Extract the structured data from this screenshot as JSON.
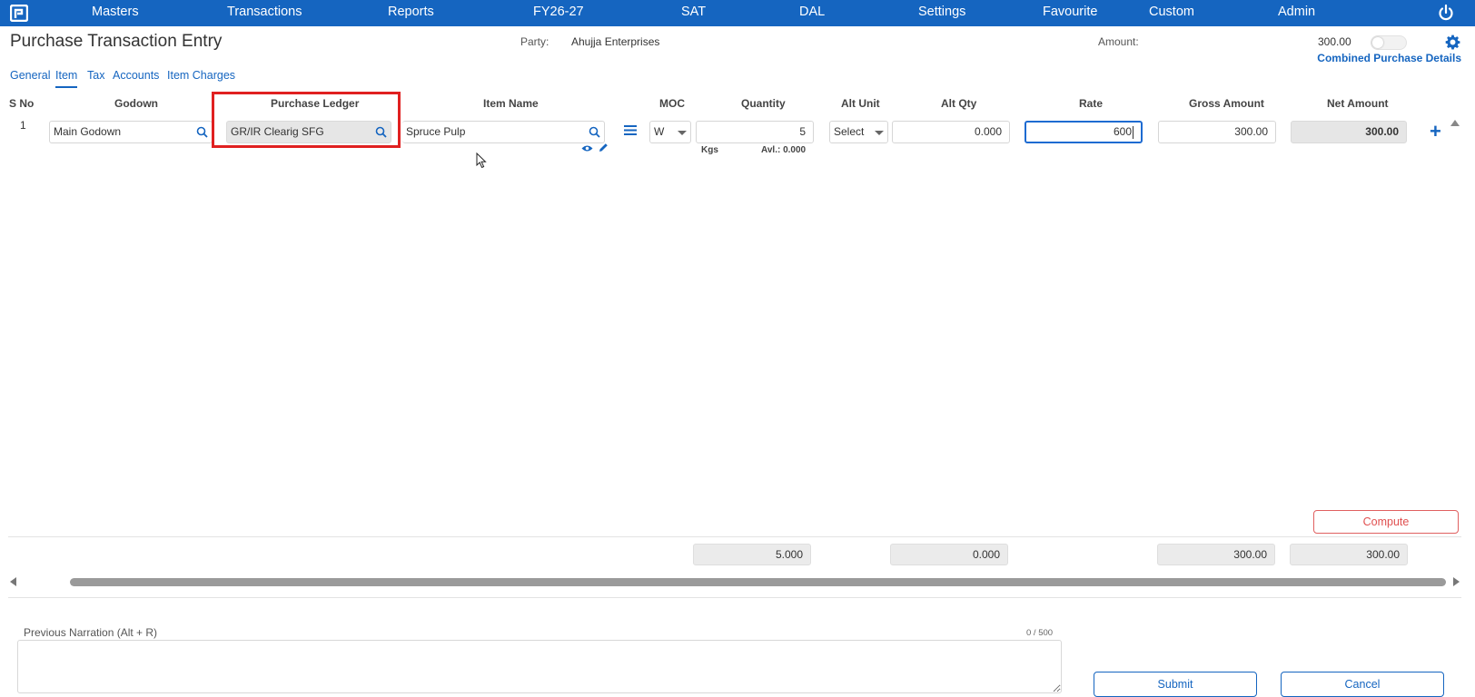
{
  "nav": {
    "items": [
      "Masters",
      "Transactions",
      "Reports",
      "FY26-27",
      "SAT",
      "DAL",
      "Settings",
      "Favourite",
      "Custom",
      "Admin"
    ]
  },
  "header": {
    "title": "Purchase Transaction Entry",
    "party_label": "Party:",
    "party_value": "Ahujja Enterprises",
    "amount_label": "Amount:",
    "amount_value": "300.00",
    "combined_link": "Combined Purchase Details"
  },
  "tabs": [
    {
      "label": "General",
      "active": false
    },
    {
      "label": "Item",
      "active": true
    },
    {
      "label": "Tax",
      "active": false
    },
    {
      "label": "Accounts",
      "active": false
    },
    {
      "label": "Item Charges",
      "active": false
    }
  ],
  "columns": {
    "sno": "S No",
    "godown": "Godown",
    "purchase_ledger": "Purchase Ledger",
    "item_name": "Item Name",
    "moc": "MOC",
    "quantity": "Quantity",
    "alt_unit": "Alt Unit",
    "alt_qty": "Alt Qty",
    "rate": "Rate",
    "gross_amount": "Gross Amount",
    "net_amount": "Net Amount"
  },
  "row": {
    "sno": "1",
    "godown": "Main Godown",
    "purchase_ledger": "GR/IR Clearig SFG",
    "item_name": "Spruce Pulp",
    "moc": "W",
    "quantity": "5",
    "unit": "Kgs",
    "avl": "Avl.: 0.000",
    "alt_unit": "Select",
    "alt_qty": "0.000",
    "rate": "600",
    "gross_amount": "300.00",
    "net_amount": "300.00"
  },
  "compute_label": "Compute",
  "totals": {
    "quantity": "5.000",
    "alt_qty": "0.000",
    "gross_amount": "300.00",
    "net_amount": "300.00"
  },
  "narration": {
    "label": "Previous Narration (Alt + R)",
    "count": "0 / 500",
    "value": ""
  },
  "buttons": {
    "submit": "Submit",
    "cancel": "Cancel"
  },
  "colors": {
    "primary": "#1565c0",
    "highlight": "#e02020",
    "compute": "#e05050"
  }
}
